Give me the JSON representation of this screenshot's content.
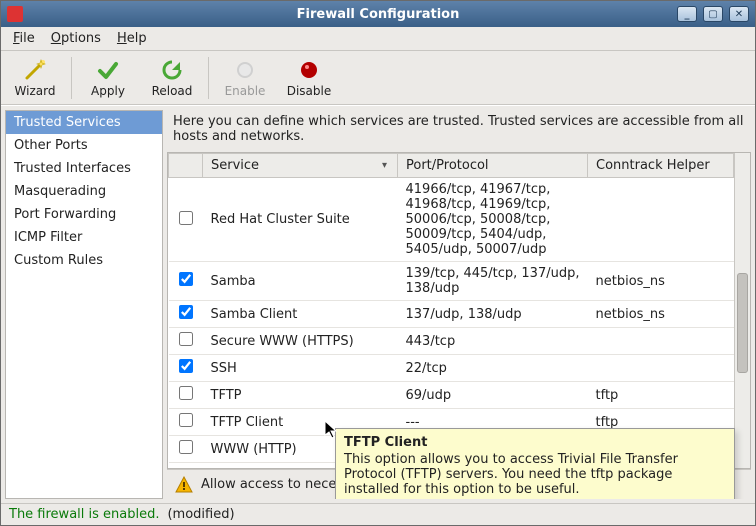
{
  "window": {
    "title": "Firewall Configuration"
  },
  "menu": {
    "file": "File",
    "options": "Options",
    "help": "Help"
  },
  "toolbar": {
    "wizard": "Wizard",
    "apply": "Apply",
    "reload": "Reload",
    "enable": "Enable",
    "disable": "Disable"
  },
  "sidebar": {
    "items": [
      "Trusted Services",
      "Other Ports",
      "Trusted Interfaces",
      "Masquerading",
      "Port Forwarding",
      "ICMP Filter",
      "Custom Rules"
    ],
    "selectedIndex": 0
  },
  "main": {
    "description": "Here you can define which services are trusted. Trusted services are accessible from all hosts and networks.",
    "columns": {
      "service": "Service",
      "port": "Port/Protocol",
      "conntrack": "Conntrack Helper"
    },
    "rows": [
      {
        "checked": false,
        "service": "Red Hat Cluster Suite",
        "port": "41966/tcp, 41967/tcp, 41968/tcp, 41969/tcp, 50006/tcp, 50008/tcp, 50009/tcp, 5404/udp, 5405/udp, 50007/udp",
        "conntrack": ""
      },
      {
        "checked": true,
        "service": "Samba",
        "port": "139/tcp, 445/tcp, 137/udp, 138/udp",
        "conntrack": "netbios_ns"
      },
      {
        "checked": true,
        "service": "Samba Client",
        "port": "137/udp, 138/udp",
        "conntrack": "netbios_ns"
      },
      {
        "checked": false,
        "service": "Secure WWW (HTTPS)",
        "port": "443/tcp",
        "conntrack": ""
      },
      {
        "checked": true,
        "service": "SSH",
        "port": "22/tcp",
        "conntrack": ""
      },
      {
        "checked": false,
        "service": "TFTP",
        "port": "69/udp",
        "conntrack": "tftp"
      },
      {
        "checked": false,
        "service": "TFTP Client",
        "port": "---",
        "conntrack": "tftp"
      },
      {
        "checked": false,
        "service": "WWW (HTTP)",
        "port": "",
        "conntrack": ""
      }
    ],
    "footer_warning": "Allow access to nece"
  },
  "tooltip": {
    "title": "TFTP Client",
    "body": "This option allows you to access Trivial File Transfer Protocol (TFTP) servers. You need the tftp package installed for this option to be useful."
  },
  "status": {
    "enabled": "The firewall is enabled.",
    "modified": "(modified)"
  }
}
